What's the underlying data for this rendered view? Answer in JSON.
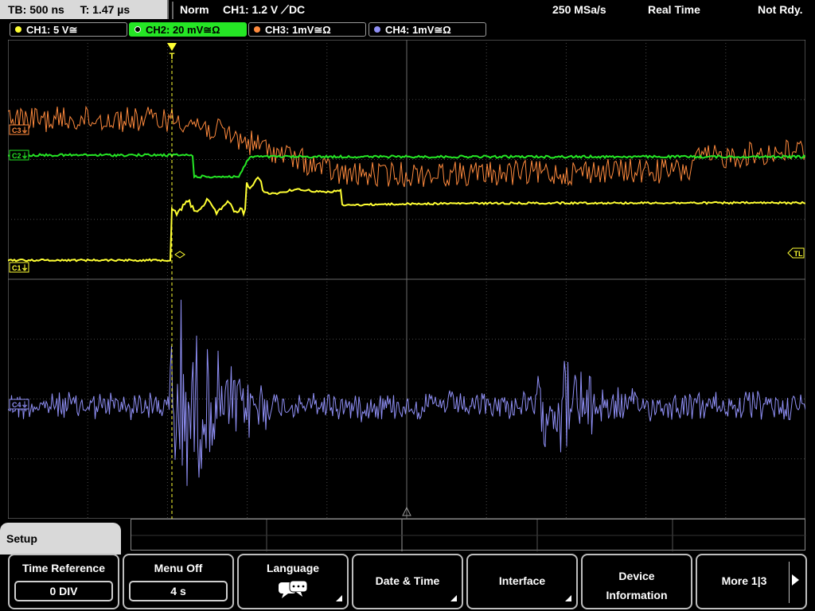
{
  "status": {
    "timebase": "TB: 500 ns",
    "trigger_time": "T: 1.47 µs",
    "mode": "Norm",
    "trigger_source": "CH1: 1.2 V ⟋DC",
    "sample_rate": "250 MSa/s",
    "acq_mode": "Real Time",
    "state": "Not Rdy."
  },
  "channels": [
    {
      "label": "CH1: 5 V≅",
      "color": "#ffff33",
      "active": false
    },
    {
      "label": "CH2: 20 mV≅Ω",
      "color": "#25e625",
      "active": true
    },
    {
      "label": "CH3: 1mV≅Ω",
      "color": "#ff8a3d",
      "active": false
    },
    {
      "label": "CH4: 1mV≅Ω",
      "color": "#8f8ff5",
      "active": false
    }
  ],
  "markers": {
    "trigger": "T",
    "trigger_level": "TL",
    "ch1": "C1",
    "ch2": "C2",
    "ch3": "C3",
    "ch4": "C4"
  },
  "menu": {
    "title": "Setup",
    "buttons": [
      {
        "label": "Time Reference",
        "value": "0 DIV"
      },
      {
        "label": "Menu Off",
        "value": "4 s"
      },
      {
        "label": "Language",
        "icon": "speech-bubbles-icon"
      },
      {
        "label": "Date & Time"
      },
      {
        "label": "Interface"
      },
      {
        "label_line1": "Device",
        "label_line2": "Information"
      },
      {
        "label": "More 1|3"
      }
    ]
  }
}
